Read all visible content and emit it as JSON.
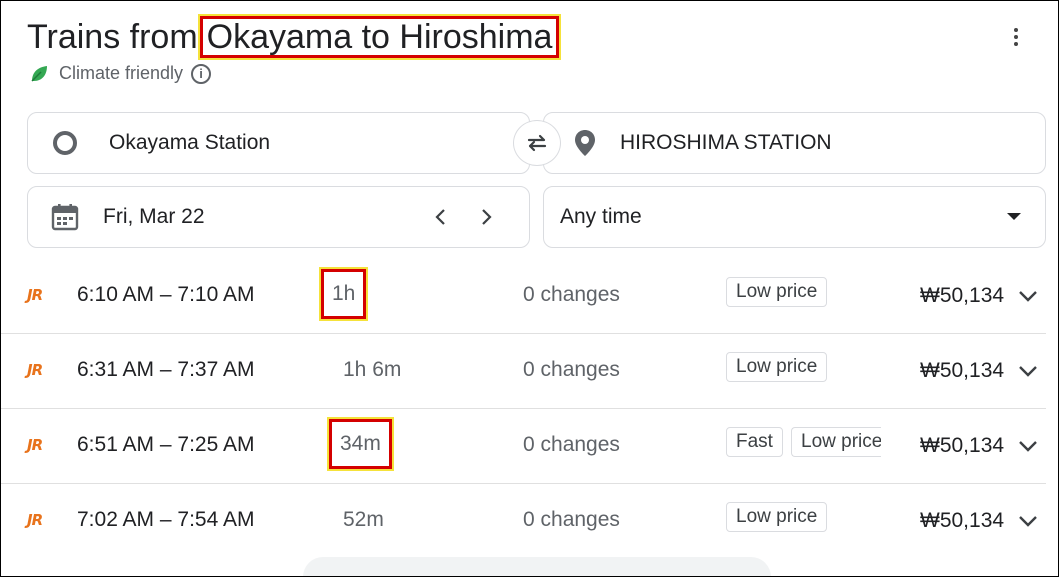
{
  "header": {
    "title_prefix": "Trains from",
    "title_route": "Okayama to Hiroshima",
    "climate_label": "Climate friendly"
  },
  "search": {
    "origin": "Okayama Station",
    "destination": "HIROSHIMA STATION",
    "date": "Fri, Mar 22",
    "time": "Any time"
  },
  "trips": [
    {
      "operator_logo": "JR",
      "times": "6:10 AM – 7:10 AM",
      "duration": "1h",
      "changes": "0 changes",
      "badges": [
        "Low price"
      ],
      "price": "₩50,134"
    },
    {
      "operator_logo": "JR",
      "times": "6:31 AM – 7:37 AM",
      "duration": "1h 6m",
      "changes": "0 changes",
      "badges": [
        "Low price"
      ],
      "price": "₩50,134"
    },
    {
      "operator_logo": "JR",
      "times": "6:51 AM – 7:25 AM",
      "duration": "34m",
      "changes": "0 changes",
      "badges": [
        "Fast",
        "Low price"
      ],
      "price": "₩50,134"
    },
    {
      "operator_logo": "JR",
      "times": "7:02 AM – 7:54 AM",
      "duration": "52m",
      "changes": "0 changes",
      "badges": [
        "Low price"
      ],
      "price": "₩50,134"
    }
  ],
  "colors": {
    "accent_highlight": "#d40000",
    "highlight_glow": "#f5e23a",
    "jr_logo": "#e8731c",
    "leaf": "#34a853"
  },
  "icons": [
    "more-vert-icon",
    "leaf-icon",
    "info-icon",
    "origin-circle-icon",
    "swap-icon",
    "location-pin-icon",
    "calendar-icon",
    "chevron-left-icon",
    "chevron-right-icon",
    "dropdown-arrow-icon",
    "expand-chevron-icon"
  ]
}
